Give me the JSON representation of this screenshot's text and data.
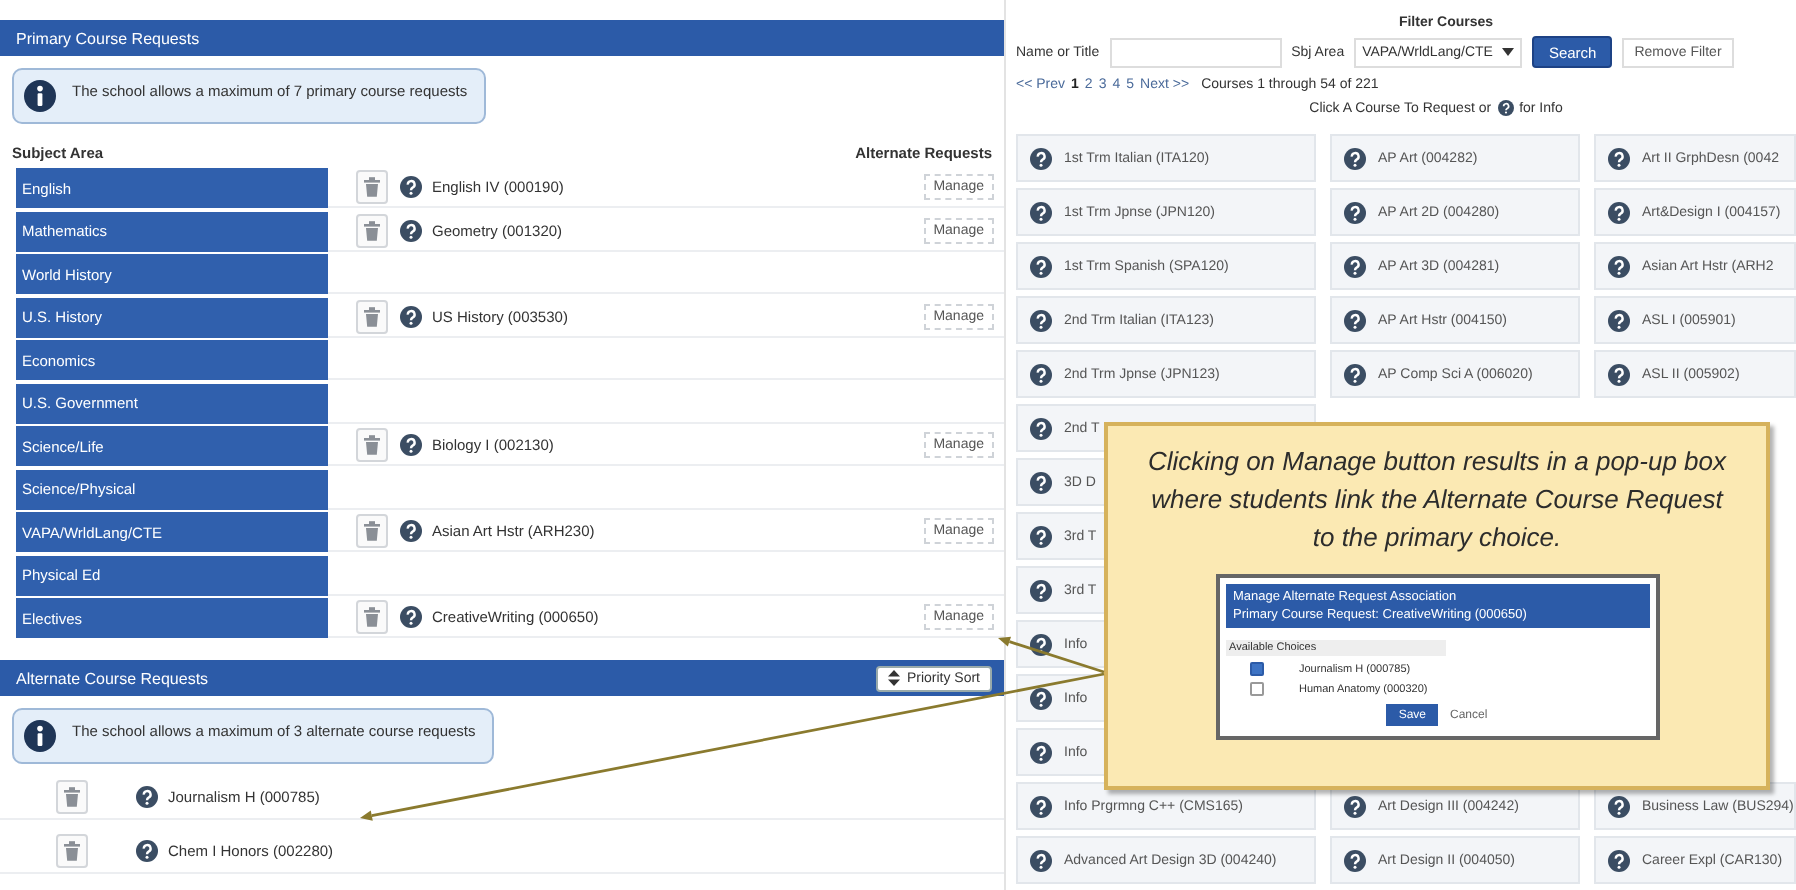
{
  "primary": {
    "title": "Primary Course Requests",
    "info": "The school allows a maximum of 7 primary course requests",
    "columns": [
      "Subject Area",
      "Alternate Requests"
    ],
    "rows": [
      {
        "subject": "English",
        "course": "English IV (000190)",
        "action": "Manage"
      },
      {
        "subject": "Mathematics",
        "course": "Geometry (001320)",
        "action": "Manage"
      },
      {
        "subject": "World History"
      },
      {
        "subject": "U.S. History",
        "course": "US History (003530)",
        "action": "Manage"
      },
      {
        "subject": "Economics"
      },
      {
        "subject": "U.S. Government"
      },
      {
        "subject": "Science/Life",
        "course": "Biology I (002130)",
        "action": "Manage"
      },
      {
        "subject": "Science/Physical"
      },
      {
        "subject": "VAPA/WrldLang/CTE",
        "course": "Asian Art Hstr (ARH230)",
        "action": "Manage"
      },
      {
        "subject": "Physical Ed"
      },
      {
        "subject": "Electives",
        "course": "CreativeWriting (000650)",
        "action": "Manage"
      }
    ]
  },
  "alternate": {
    "title": "Alternate Course Requests",
    "sort_button": "Priority Sort",
    "info": "The school allows a maximum of 3 alternate course requests",
    "rows": [
      {
        "course": "Journalism H (000785)"
      },
      {
        "course": "Chem I Honors (002280)"
      }
    ]
  },
  "filter": {
    "title": "Filter Courses",
    "name_label": "Name or Title",
    "area_label": "Sbj Area",
    "area_value": "VAPA/WrldLang/CTE",
    "search_button": "Search",
    "remove_button": "Remove Filter"
  },
  "pagination": {
    "prev": "<< Prev",
    "pages": [
      {
        "label": "1",
        "selected": true
      },
      {
        "label": "2",
        "selected": false
      },
      {
        "label": "3",
        "selected": false
      },
      {
        "label": "4",
        "selected": false
      },
      {
        "label": "5",
        "selected": false
      }
    ],
    "next": "Next >>",
    "summary": "Courses 1 through 54 of 221"
  },
  "instruction": {
    "before": "Click A Course To Request or",
    "after": "for Info"
  },
  "courses": [
    [
      "1st Trm Italian (ITA120)",
      "AP Art (004282)",
      "Art II GrphDesn (0042"
    ],
    [
      "1st Trm Jpnse (JPN120)",
      "AP Art 2D (004280)",
      "Art&Design I (004157)"
    ],
    [
      "1st Trm Spanish (SPA120)",
      "AP Art 3D (004281)",
      "Asian Art Hstr (ARH2"
    ],
    [
      "2nd Trm Italian (ITA123)",
      "AP Art Hstr (004150)",
      "ASL I (005901)"
    ],
    [
      "2nd Trm Jpnse (JPN123)",
      "AP Comp Sci A (006020)",
      "ASL II (005902)"
    ],
    [
      "2nd T"
    ],
    [
      "3D D"
    ],
    [
      "3rd T"
    ],
    [
      "3rd T"
    ],
    [
      "Info"
    ],
    [
      "Info"
    ],
    [
      "Info"
    ],
    [
      "Info Prgrmng C++ (CMS165)",
      "Art Design III (004242)",
      "Business Law (BUS294)"
    ],
    [
      "Advanced Art Design 3D (004240)",
      "Art Design II (004050)",
      "Career Expl (CAR130)"
    ]
  ],
  "callout": {
    "text": "Clicking on Manage button results in a pop-up box where students link the Alternate Course Request to the primary choice.",
    "dialog": {
      "title": "Manage Alternate Request Association",
      "subtitle": "Primary Course Request: CreativeWriting (000650)",
      "choices_label": "Available Choices",
      "choices": [
        {
          "label": "Journalism H (000785)",
          "checked": true
        },
        {
          "label": "Human Anatomy (000320)",
          "checked": false
        }
      ],
      "save": "Save",
      "cancel": "Cancel"
    }
  }
}
